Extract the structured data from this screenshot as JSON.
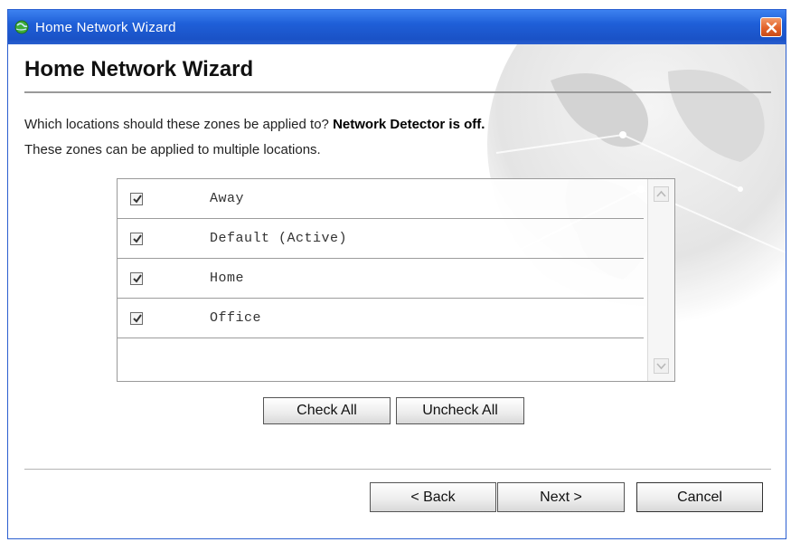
{
  "window": {
    "title": "Home Network Wizard",
    "close_icon": "close-icon",
    "app_icon": "network-globe-icon"
  },
  "header": {
    "heading": "Home Network Wizard"
  },
  "description": {
    "line1_prefix": "Which locations should these zones be applied to? ",
    "line1_bold": "Network Detector is off.",
    "line2": "These zones can be applied to multiple locations."
  },
  "zones": {
    "items": [
      {
        "label": "Away",
        "checked": true
      },
      {
        "label": "Default (Active)",
        "checked": true
      },
      {
        "label": "Home",
        "checked": true
      },
      {
        "label": "Office",
        "checked": true
      }
    ]
  },
  "buttons": {
    "check_all": "Check All",
    "uncheck_all": "Uncheck All",
    "back": "< Back",
    "next": "Next >",
    "cancel": "Cancel"
  },
  "colors": {
    "titlebar": "#1f5fd8",
    "close": "#e26229",
    "text": "#111111"
  }
}
